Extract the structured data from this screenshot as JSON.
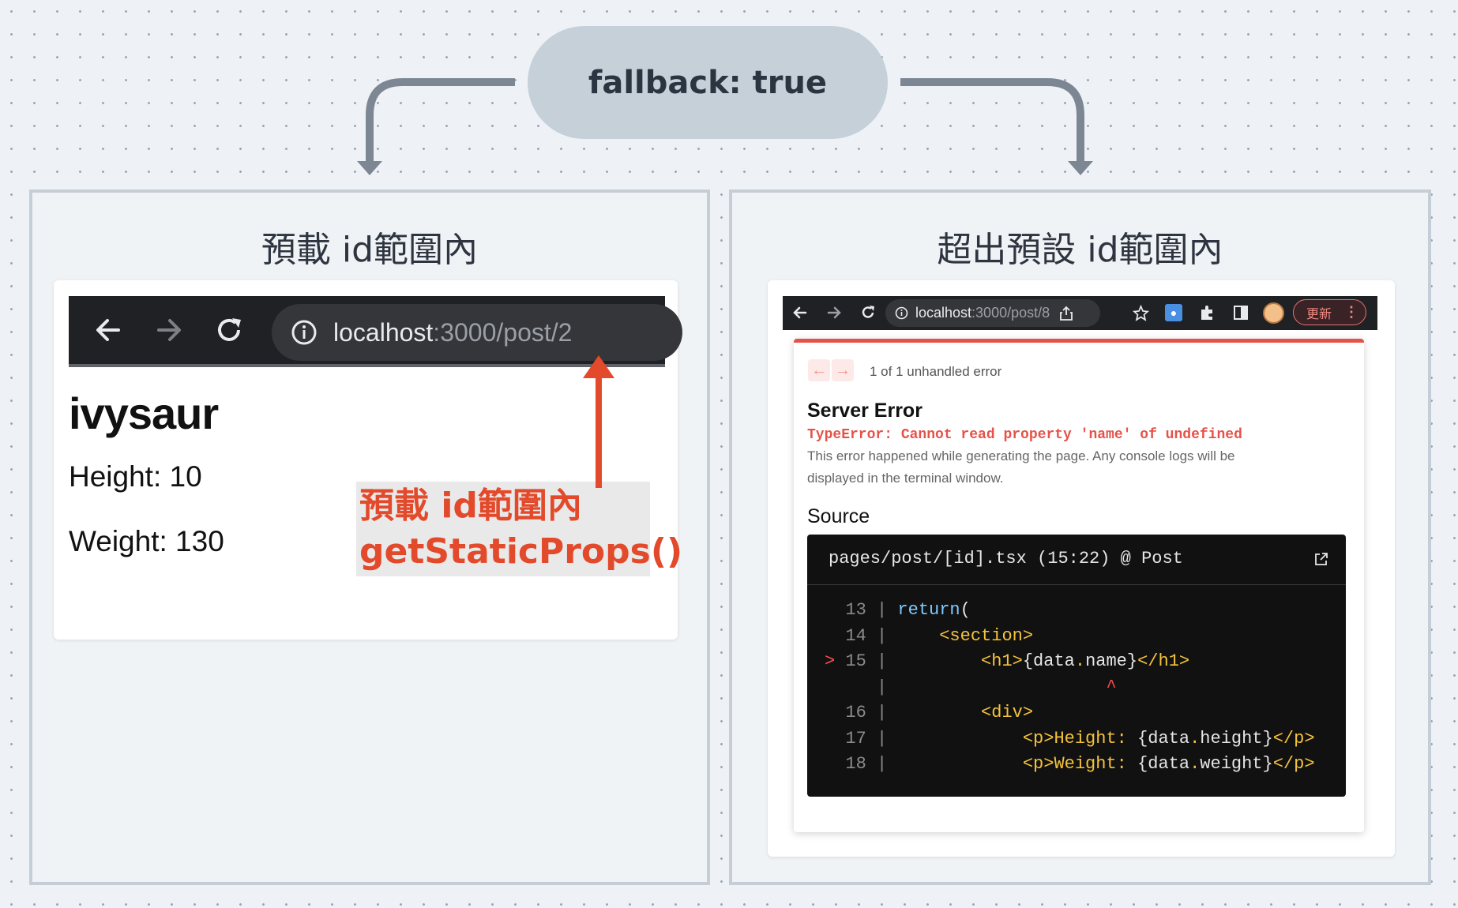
{
  "header": {
    "title": "fallback: true"
  },
  "left_panel": {
    "title": "預載 id範圍內",
    "browser": {
      "host": "localhost",
      "path": ":3000/post/2"
    },
    "page": {
      "heading": "ivysaur",
      "height": "Height: 10",
      "weight": "Weight: 130"
    },
    "annotation": {
      "line1": "預載 id範圍內",
      "line2": "getStaticProps()"
    }
  },
  "right_panel": {
    "title": "超出預設 id範圍內",
    "browser": {
      "host": "localhost",
      "path": ":3000/post/8",
      "update_label": "更新"
    },
    "error": {
      "count": "1 of 1 unhandled error",
      "title": "Server Error",
      "type": "TypeError: Cannot read property 'name' of undefined",
      "description_1": "This error happened while generating the page. Any console logs will be",
      "description_2": "displayed in the terminal window.",
      "source_heading": "Source",
      "source_file": "pages/post/[id].tsx (15:22) @ Post"
    }
  },
  "colors": {
    "accent_red": "#e34a2b",
    "error_red": "#e5524a",
    "arrow": "#7d8794"
  }
}
